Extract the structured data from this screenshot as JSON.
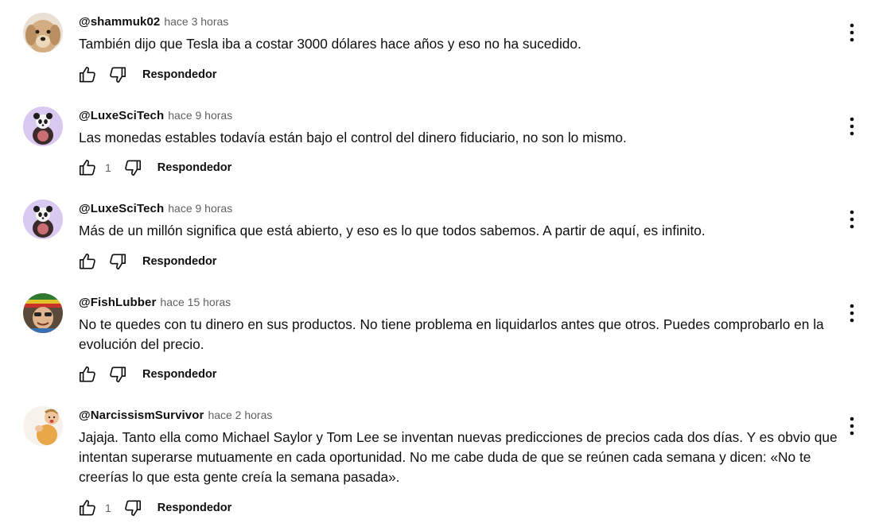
{
  "comments": [
    {
      "author": "@shammuk02",
      "time": "hace 3 horas",
      "text": "También dijo que Tesla iba a costar 3000 dólares hace años y eso no ha sucedido.",
      "likes": "",
      "reply_label": "Respondedor",
      "avatar": "dog-avatar"
    },
    {
      "author": "@LuxeSciTech",
      "time": "hace 9 horas",
      "text": "Las monedas estables todavía están bajo el control del dinero fiduciario, no son lo mismo.",
      "likes": "1",
      "reply_label": "Respondedor",
      "avatar": "panda-avatar"
    },
    {
      "author": "@LuxeSciTech",
      "time": "hace 9 horas",
      "text": "Más de un millón significa que está abierto, y eso es lo que todos sabemos. A partir de aquí, es infinito.",
      "likes": "",
      "reply_label": "Respondedor",
      "avatar": "panda-avatar"
    },
    {
      "author": "@FishLubber",
      "time": "hace 15 horas",
      "text": "No te quedes con tu dinero en sus productos. No tiene problema en liquidarlos antes que otros. Puedes comprobarlo en la evolución del precio.",
      "likes": "",
      "reply_label": "Respondedor",
      "avatar": "person-avatar"
    },
    {
      "author": "@NarcissismSurvivor",
      "time": "hace 2 horas",
      "text": "Jajaja. Tanto ella como Michael Saylor y Tom Lee se inventan nuevas predicciones de precios cada dos días. Y es obvio que intentan superarse mutuamente en cada oportunidad. No me cabe duda de que se reúnen cada semana y dicen: «No te creerías lo que esta gente creía la semana pasada».",
      "likes": "1",
      "reply_label": "Respondedor",
      "avatar": "baby-avatar"
    }
  ],
  "icons": {
    "like": "thumbs-up-icon",
    "dislike": "thumbs-down-icon",
    "menu": "more-vert-icon"
  },
  "colors": {
    "text": "#0f0f0f",
    "secondary": "#606060",
    "background": "#ffffff"
  }
}
